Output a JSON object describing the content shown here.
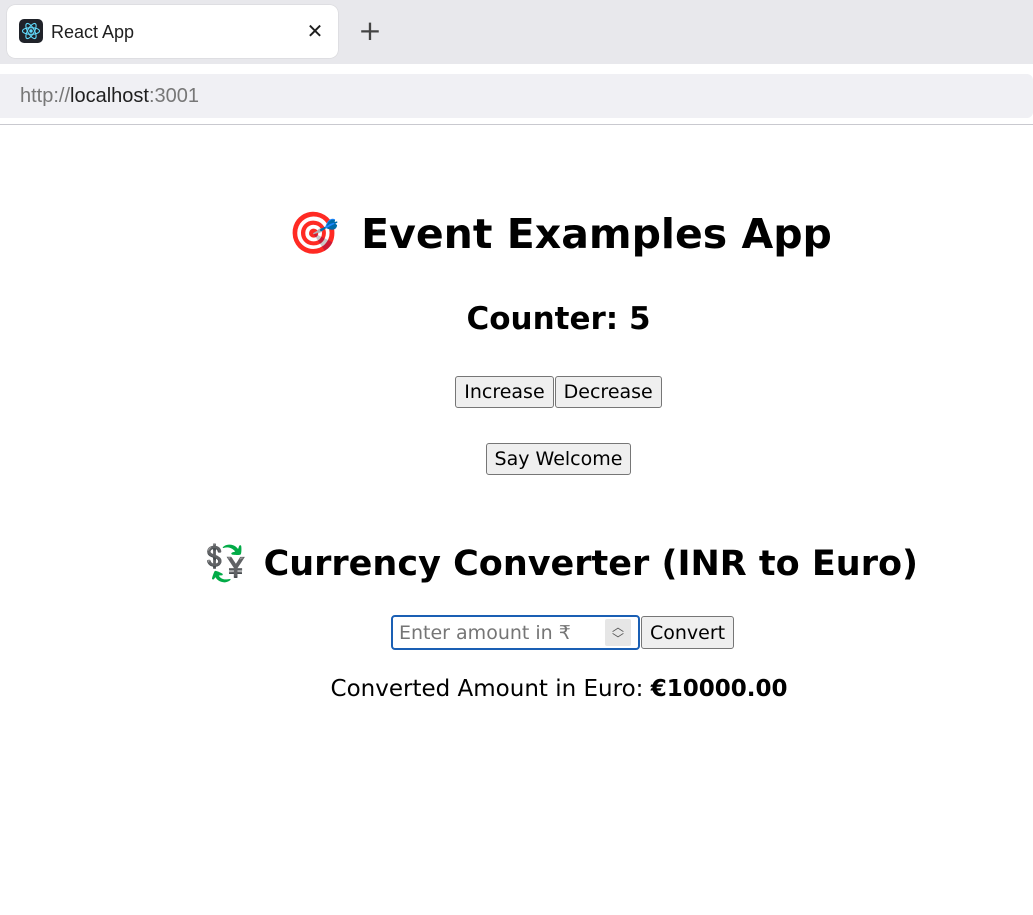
{
  "browser": {
    "tab_title": "React App",
    "tab_close_glyph": "✕",
    "new_tab_glyph": "+",
    "url_scheme": "http://",
    "url_host": "localhost",
    "url_port": ":3001"
  },
  "app": {
    "title_emoji": "🎯",
    "title": "Event Examples App",
    "counter_label": "Counter: 5",
    "increase_label": "Increase",
    "decrease_label": "Decrease",
    "welcome_label": "Say Welcome"
  },
  "converter": {
    "title_emoji": "💱",
    "title": "Currency Converter (INR to Euro)",
    "input_value": "",
    "input_placeholder": "Enter amount in ₹",
    "convert_label": "Convert",
    "result_label": "Converted Amount in Euro: ",
    "result_value": "€10000.00"
  },
  "icons": {
    "favicon": "react-logo-icon",
    "title": "direct-hit-icon",
    "converter": "currency-exchange-icon",
    "spinner": "number-spinner-icon"
  },
  "colors": {
    "focus_ring": "#1a5fb4",
    "react_blue": "#61dafb",
    "tabstrip_bg": "#e8e8ec"
  }
}
